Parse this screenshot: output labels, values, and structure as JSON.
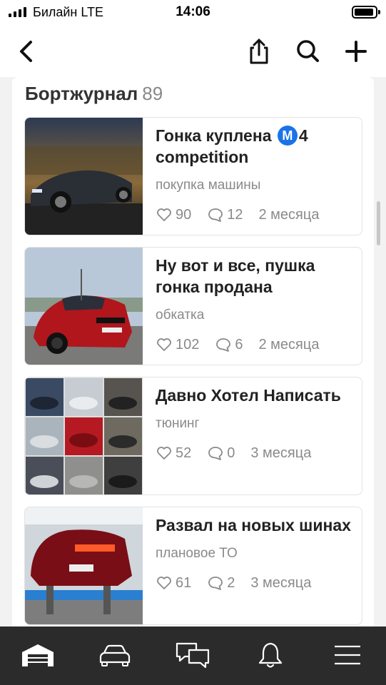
{
  "status_bar": {
    "carrier": "Билайн  LTE",
    "time": "14:06"
  },
  "nav": {
    "back_icon": "chevron-left-icon",
    "share_icon": "share-icon",
    "search_icon": "search-icon",
    "add_icon": "plus-icon"
  },
  "logbook": {
    "title": "Бортжурнал",
    "count": "89",
    "entries": [
      {
        "title_pre": "Гонка куплена ",
        "metro_badge": "M",
        "title_post": "4 competition",
        "tag": "покупка машины",
        "likes": "90",
        "comments": "12",
        "date": "2 месяца"
      },
      {
        "title": "Ну вот и все, пушка гонка продана",
        "tag": "обкатка",
        "likes": "102",
        "comments": "6",
        "date": "2 месяца"
      },
      {
        "title": "Давно Хотел Написать",
        "tag": "тюнинг",
        "likes": "52",
        "comments": "0",
        "date": "3 месяца"
      },
      {
        "title": "Развал на новых шинах",
        "tag": "плановое ТО",
        "likes": "61",
        "comments": "2",
        "date": "3 месяца"
      }
    ]
  },
  "tab_bar": {
    "items": [
      "garage-icon",
      "car-icon",
      "chat-icon",
      "bell-icon",
      "menu-icon"
    ],
    "active": "garage-icon"
  },
  "colors": {
    "accent_metro": "#1a73e8",
    "tab_bar_bg": "#2b2b2b",
    "muted_text": "#8a8a8a"
  }
}
